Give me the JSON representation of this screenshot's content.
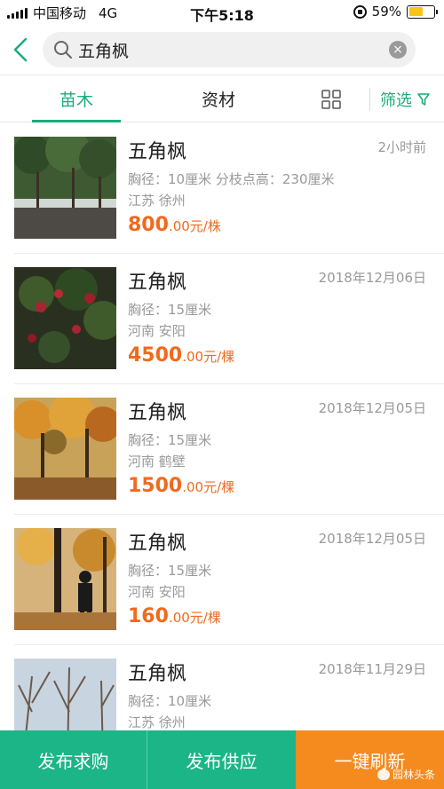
{
  "status_bar": {
    "carrier": "中国移动",
    "network": "4G",
    "time": "下午5:18",
    "battery": "59%",
    "battery_level": 0.59
  },
  "search": {
    "query": "五角枫"
  },
  "tabs": {
    "seedling": "苗木",
    "material": "资材",
    "filter": "筛选"
  },
  "listings": [
    {
      "title": "五角枫",
      "time": "2小时前",
      "spec": "胸径：10厘米 分枝点高：230厘米",
      "location": "江苏 徐州",
      "price_int": "800",
      "price_unit": ".00元/株"
    },
    {
      "title": "五角枫",
      "time": "2018年12月06日",
      "spec": "胸径：15厘米",
      "location": "河南 安阳",
      "price_int": "4500",
      "price_unit": ".00元/棵"
    },
    {
      "title": "五角枫",
      "time": "2018年12月05日",
      "spec": "胸径：15厘米",
      "location": "河南 鹤壁",
      "price_int": "1500",
      "price_unit": ".00元/棵"
    },
    {
      "title": "五角枫",
      "time": "2018年12月05日",
      "spec": "胸径：15厘米",
      "location": "河南 安阳",
      "price_int": "160",
      "price_unit": ".00元/棵"
    },
    {
      "title": "五角枫",
      "time": "2018年11月29日",
      "spec": "胸径：10厘米",
      "location": "江苏 徐州",
      "price_int": "",
      "price_unit": ""
    }
  ],
  "bottom_bar": {
    "buy": "发布求购",
    "supply": "发布供应",
    "refresh": "一键刷新",
    "watermark": "园林头条"
  },
  "colors": {
    "accent": "#1aae7a",
    "price": "#f06a1d",
    "refresh": "#f58a1f"
  }
}
